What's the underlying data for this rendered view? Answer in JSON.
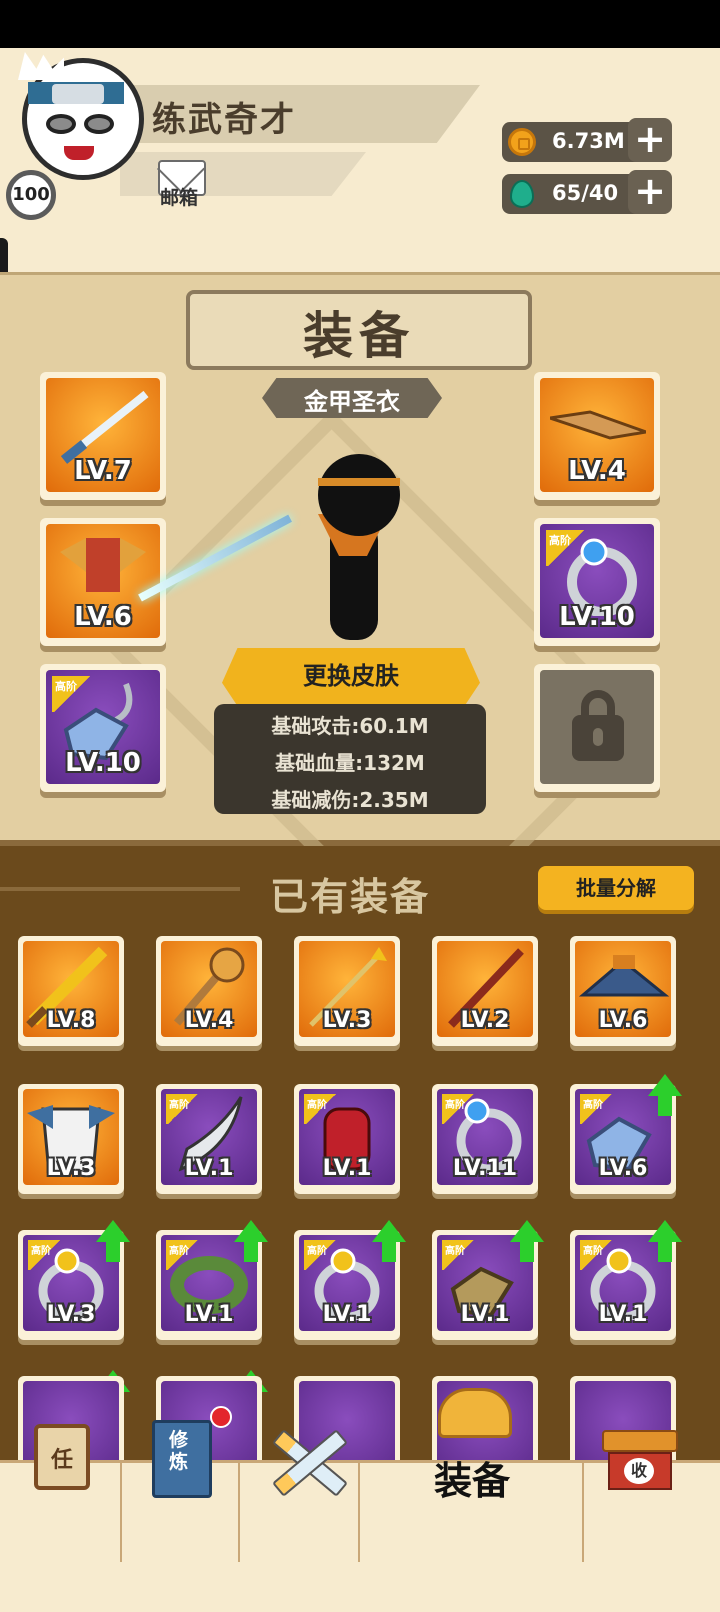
{
  "player": {
    "name": "练武奇才",
    "level": "100",
    "mail_label": "邮箱"
  },
  "resources": {
    "gold": "6.73M",
    "gems": "65/40"
  },
  "equipment": {
    "title": "装备",
    "skin_name": "金甲圣衣",
    "change_skin_label": "更换皮肤",
    "stats": [
      "基础攻击:60.1M",
      "基础血量:132M",
      "基础减伤:2.35M"
    ],
    "tier_label": "高阶",
    "slots_left": [
      {
        "lv": "LV.7",
        "tier": "orange",
        "item": "sword"
      },
      {
        "lv": "LV.6",
        "tier": "orange",
        "item": "armor"
      },
      {
        "lv": "LV.10",
        "tier": "purple",
        "item": "amulet",
        "advanced": true
      }
    ],
    "slots_right": [
      {
        "lv": "LV.4",
        "tier": "orange",
        "item": "headband"
      },
      {
        "lv": "LV.10",
        "tier": "purple",
        "item": "ring",
        "advanced": true
      }
    ]
  },
  "inventory": {
    "title": "已有装备",
    "batch_label": "批量分解",
    "rows": [
      [
        {
          "lv": "LV.8",
          "tier": "orange",
          "item": "broadsword"
        },
        {
          "lv": "LV.4",
          "tier": "orange",
          "item": "mace"
        },
        {
          "lv": "LV.3",
          "tier": "orange",
          "item": "spear"
        },
        {
          "lv": "LV.2",
          "tier": "orange",
          "item": "staff"
        },
        {
          "lv": "LV.6",
          "tier": "orange",
          "item": "hat"
        }
      ],
      [
        {
          "lv": "LV.3",
          "tier": "orange",
          "item": "robe"
        },
        {
          "lv": "LV.1",
          "tier": "purple",
          "item": "blade",
          "advanced": true
        },
        {
          "lv": "LV.1",
          "tier": "purple",
          "item": "gauntlet",
          "advanced": true
        },
        {
          "lv": "LV.11",
          "tier": "purple",
          "item": "ring-blue",
          "advanced": true
        },
        {
          "lv": "LV.6",
          "tier": "purple",
          "item": "amulet",
          "advanced": true,
          "upgrade": true
        }
      ],
      [
        {
          "lv": "LV.3",
          "tier": "purple",
          "item": "ring-gold",
          "advanced": true,
          "upgrade": true
        },
        {
          "lv": "LV.1",
          "tier": "purple",
          "item": "bracelet",
          "advanced": true,
          "upgrade": true
        },
        {
          "lv": "LV.1",
          "tier": "purple",
          "item": "ring-gold",
          "advanced": true,
          "upgrade": true
        },
        {
          "lv": "LV.1",
          "tier": "purple",
          "item": "amulet-gold",
          "advanced": true,
          "upgrade": true
        },
        {
          "lv": "LV.1",
          "tier": "purple",
          "item": "ring-gold",
          "advanced": true,
          "upgrade": true
        }
      ]
    ]
  },
  "nav": {
    "task_label": "任",
    "cultivate_label": "修炼",
    "shop_label": "收",
    "active_label": "装备",
    "items": [
      "task-icon",
      "cultivate-book-icon",
      "battle-swords-icon",
      "equipment-helmet-icon",
      "shop-icon"
    ]
  },
  "colors": {
    "panel_bg": "#e3cfa2",
    "inventory_bg": "#6b4a1c",
    "orange_tier": "#f08a17",
    "purple_tier": "#6b34a0",
    "upgrade_arrow": "#2ccf2c",
    "button_yellow": "#f4b320"
  }
}
